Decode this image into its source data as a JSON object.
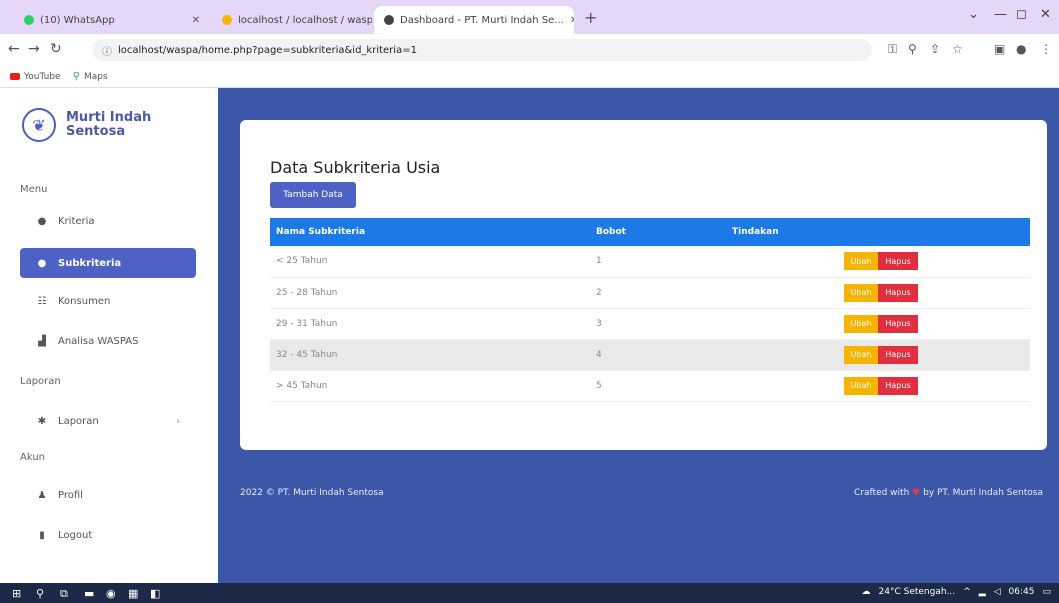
{
  "browser": {
    "tabs": [
      {
        "title": "(10) WhatsApp",
        "favicon_color": "#25d366"
      },
      {
        "title": "localhost / localhost / waspa | ph...",
        "favicon_color": "#f4b400"
      },
      {
        "title": "Dashboard - PT. Murti Indah Se...",
        "favicon_color": "#444444"
      }
    ],
    "url": "localhost/waspa/home.php?page=subkriteria&id_kriteria=1",
    "bookmarks": [
      "YouTube",
      "Maps"
    ]
  },
  "sidebar": {
    "brand": "Murti Indah Sentosa",
    "sections": [
      {
        "heading": "Menu",
        "items": [
          {
            "label": "Kriteria",
            "icon": "circle-icon"
          },
          {
            "label": "Subkriteria",
            "icon": "circle-icon",
            "active": true
          },
          {
            "label": "Konsumen",
            "icon": "users-icon"
          },
          {
            "label": "Analisa WASPAS",
            "icon": "chart-icon"
          }
        ]
      },
      {
        "heading": "Laporan",
        "items": [
          {
            "label": "Laporan",
            "icon": "gear-icon"
          }
        ]
      },
      {
        "heading": "Akun",
        "items": [
          {
            "label": "Profil",
            "icon": "user-icon"
          },
          {
            "label": "Logout",
            "icon": "logout-icon"
          }
        ]
      }
    ]
  },
  "main": {
    "title": "Data Subkriteria Usia",
    "add_button": "Tambah Data",
    "table": {
      "headers": [
        "Nama Subkriteria",
        "Bobot",
        "Tindakan"
      ],
      "rows": [
        {
          "nama": "< 25 Tahun",
          "bobot": "1"
        },
        {
          "nama": "25 - 28 Tahun",
          "bobot": "2"
        },
        {
          "nama": "29 - 31 Tahun",
          "bobot": "3"
        },
        {
          "nama": "32 - 45 Tahun",
          "bobot": "4"
        },
        {
          "nama": "> 45 Tahun",
          "bobot": "5"
        }
      ],
      "edit_label": "Ubah",
      "delete_label": "Hapus"
    },
    "footer_left": "2022 © PT. Murti Indah Sentosa",
    "footer_right_pre": "Crafted with",
    "footer_right_post": "by PT. Murti Indah Sentosa"
  },
  "taskbar": {
    "weather": "24°C Setengah...",
    "time": "06:45"
  },
  "colors": {
    "primary": "#4e61c4",
    "table_header": "#1c7ae8",
    "edit": "#f4b400",
    "delete": "#e0303f"
  }
}
